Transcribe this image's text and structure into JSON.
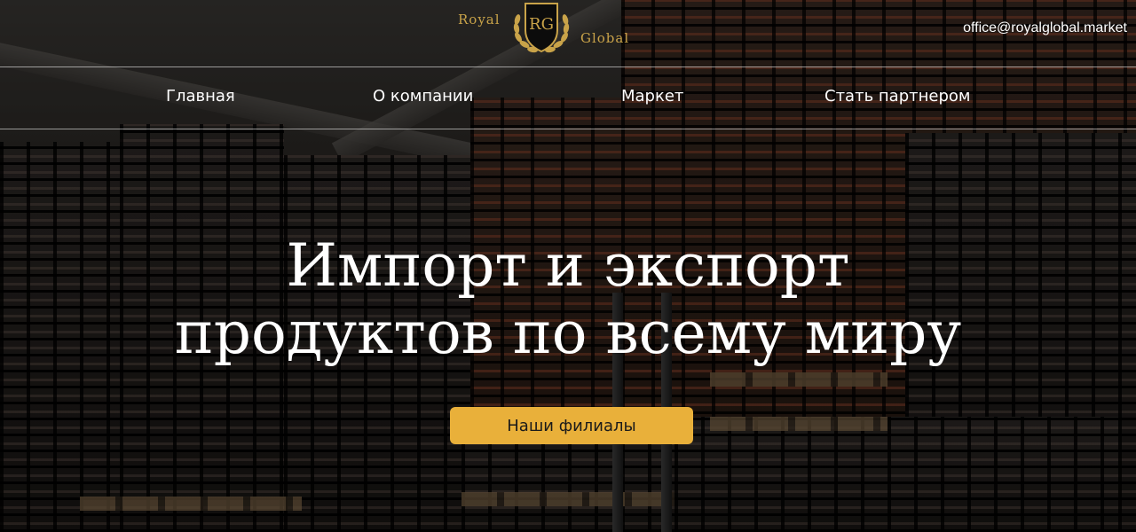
{
  "brand": {
    "word_left": "Royal",
    "word_right": "Global",
    "monogram": "RG",
    "gold_color": "#c9a349"
  },
  "header": {
    "email": "office@royalglobal.market"
  },
  "nav": {
    "items": [
      {
        "label": "Главная"
      },
      {
        "label": "О компании"
      },
      {
        "label": "Маркет"
      },
      {
        "label": "Стать партнером"
      }
    ]
  },
  "hero": {
    "title_line1": "Импорт и экспорт",
    "title_line2": "продуктов по всему миру",
    "cta_label": "Наши филиалы",
    "cta_color": "#e9b03a"
  }
}
